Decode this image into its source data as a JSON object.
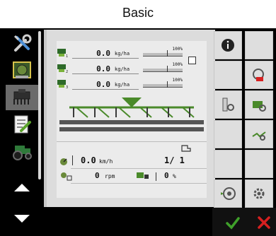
{
  "page": {
    "title": "Basic"
  },
  "rates": [
    {
      "value": "0.0",
      "unit": "kg/ha",
      "scale": "100%"
    },
    {
      "value": "0.0",
      "unit": "kg/ha",
      "scale": "100%"
    },
    {
      "value": "0.0",
      "unit": "kg/ha",
      "scale": "100%"
    }
  ],
  "status": {
    "speed_value": "0.0",
    "speed_unit": "km/h",
    "section_count": "1/ 1",
    "rpm_value": "0",
    "rpm_unit": "rpm",
    "percent_value": "0",
    "percent_unit": "%"
  },
  "icons": {
    "left": [
      "tools-icon",
      "machine-monitor-icon",
      "seeder-icon",
      "checklist-icon",
      "tractor-icon"
    ],
    "right": [
      "info-icon",
      "calibration-icon",
      "metering-icon",
      "seed-hopper-icon",
      "flow-icon",
      "wheel-icon",
      "settings-icon"
    ]
  },
  "colors": {
    "accent_green": "#4a8a2a",
    "background_dark": "#000000",
    "panel": "#ebebeb",
    "cancel_red": "#d62020",
    "confirm_green": "#3fa02a"
  }
}
